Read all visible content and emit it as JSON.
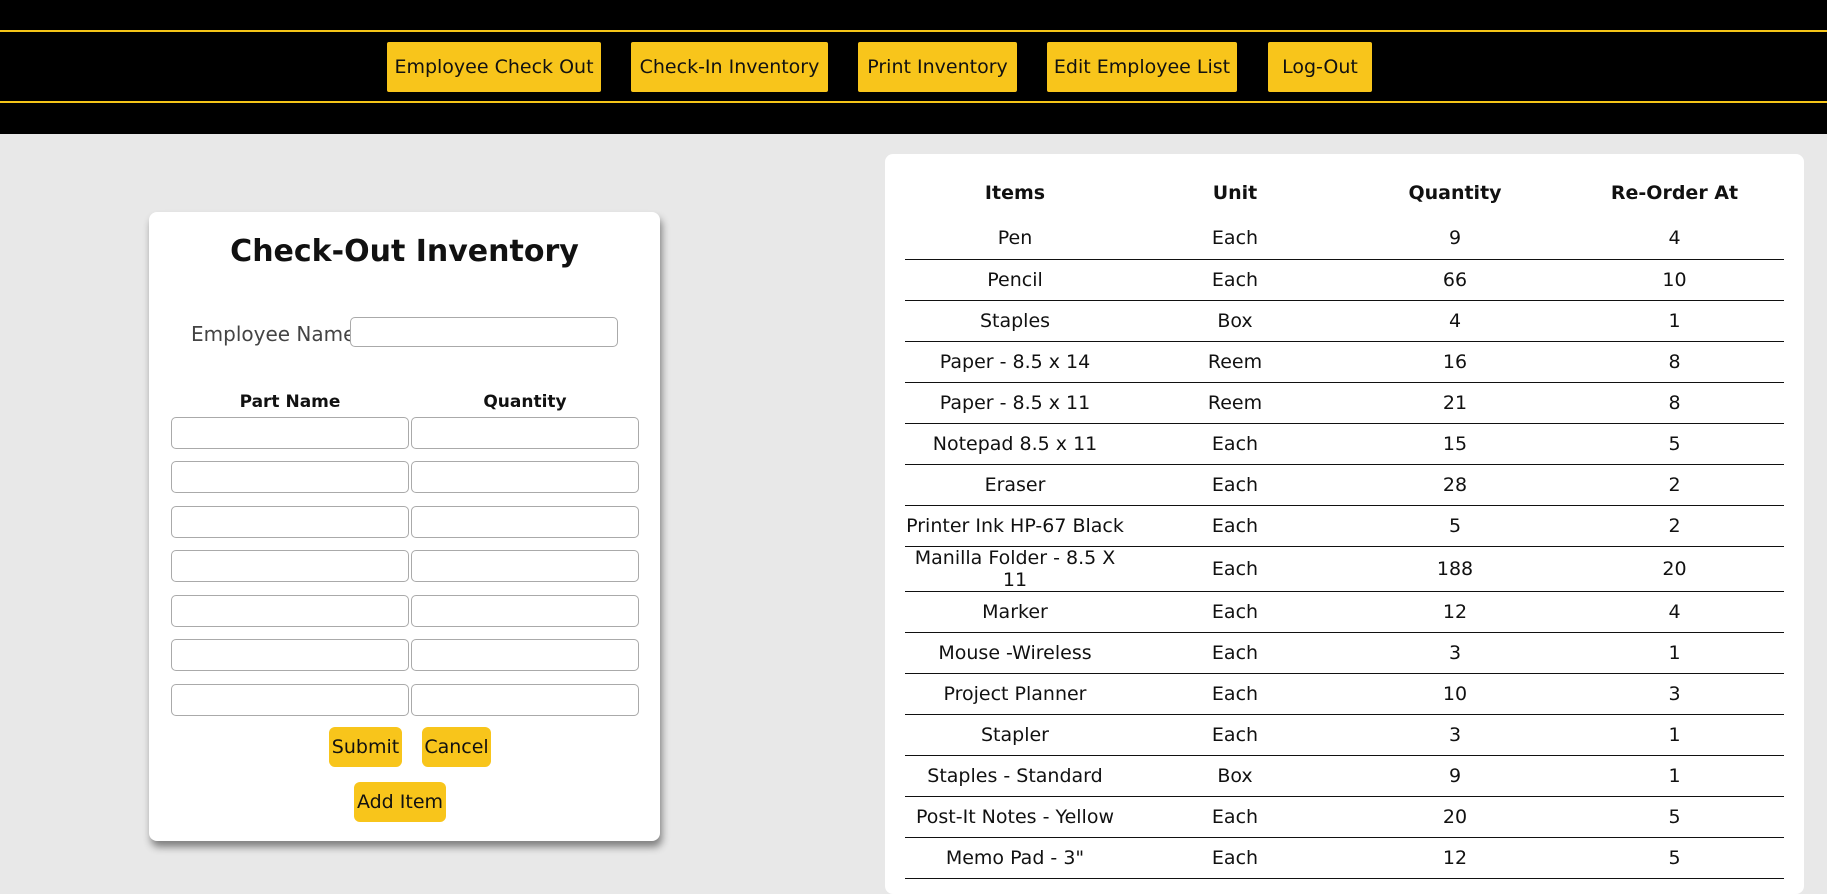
{
  "nav": {
    "items": [
      {
        "label": "Employee Check Out"
      },
      {
        "label": "Check-In Inventory"
      },
      {
        "label": "Print Inventory"
      },
      {
        "label": "Edit Employee List"
      },
      {
        "label": "Log-Out"
      }
    ]
  },
  "checkout": {
    "title": "Check-Out Inventory",
    "employee_label": "Employee Name:",
    "employee_value": "",
    "part_header": "Part Name",
    "qty_header": "Quantity",
    "rows": [
      {
        "part": "",
        "qty": ""
      },
      {
        "part": "",
        "qty": ""
      },
      {
        "part": "",
        "qty": ""
      },
      {
        "part": "",
        "qty": ""
      },
      {
        "part": "",
        "qty": ""
      },
      {
        "part": "",
        "qty": ""
      },
      {
        "part": "",
        "qty": ""
      }
    ],
    "submit_label": "Submit",
    "cancel_label": "Cancel",
    "add_item_label": "Add Item"
  },
  "inventory": {
    "headers": [
      "Items",
      "Unit",
      "Quantity",
      "Re-Order At"
    ],
    "rows": [
      [
        "Pen",
        "Each",
        "9",
        "4"
      ],
      [
        "Pencil",
        "Each",
        "66",
        "10"
      ],
      [
        "Staples",
        "Box",
        "4",
        "1"
      ],
      [
        "Paper - 8.5 x 14",
        "Reem",
        "16",
        "8"
      ],
      [
        "Paper - 8.5 x 11",
        "Reem",
        "21",
        "8"
      ],
      [
        "Notepad 8.5 x 11",
        "Each",
        "15",
        "5"
      ],
      [
        "Eraser",
        "Each",
        "28",
        "2"
      ],
      [
        "Printer Ink HP-67 Black",
        "Each",
        "5",
        "2"
      ],
      [
        "Manilla Folder - 8.5 X 11",
        "Each",
        "188",
        "20"
      ],
      [
        "Marker",
        "Each",
        "12",
        "4"
      ],
      [
        "Mouse -Wireless",
        "Each",
        "3",
        "1"
      ],
      [
        "Project Planner",
        "Each",
        "10",
        "3"
      ],
      [
        "Stapler",
        "Each",
        "3",
        "1"
      ],
      [
        "Staples - Standard",
        "Box",
        "9",
        "1"
      ],
      [
        "Post-It Notes - Yellow",
        "Each",
        "20",
        "5"
      ],
      [
        "Memo Pad - 3\"",
        "Each",
        "12",
        "5"
      ]
    ]
  },
  "colors": {
    "accent_yellow": "#f8c51b",
    "header_black": "#000000",
    "page_bg": "#e8e8e8"
  }
}
